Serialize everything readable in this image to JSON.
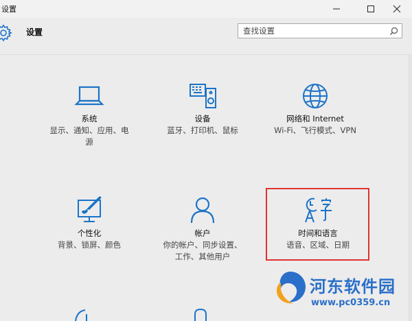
{
  "window": {
    "title": "设置"
  },
  "header": {
    "title": "设置"
  },
  "search": {
    "placeholder": "查找设置"
  },
  "tiles": [
    {
      "name": "系统",
      "desc": [
        "显示、通知、应用、电",
        "源"
      ]
    },
    {
      "name": "设备",
      "desc": [
        "蓝牙、打印机、鼠标"
      ]
    },
    {
      "name": "网络和 Internet",
      "desc": [
        "Wi-Fi、飞行模式、VPN"
      ]
    },
    {
      "name": "个性化",
      "desc": [
        "背景、锁屏、颜色"
      ]
    },
    {
      "name": "帐户",
      "desc": [
        "你的帐户、同步设置、",
        "工作、其他用户"
      ]
    },
    {
      "name": "时间和语言",
      "desc": [
        "语音、区域、日期"
      ]
    }
  ],
  "watermark": {
    "name": "河东软件园",
    "url": "www.pc0359.cn"
  },
  "colors": {
    "accent": "#1a73c7",
    "highlight": "#e0322f"
  }
}
